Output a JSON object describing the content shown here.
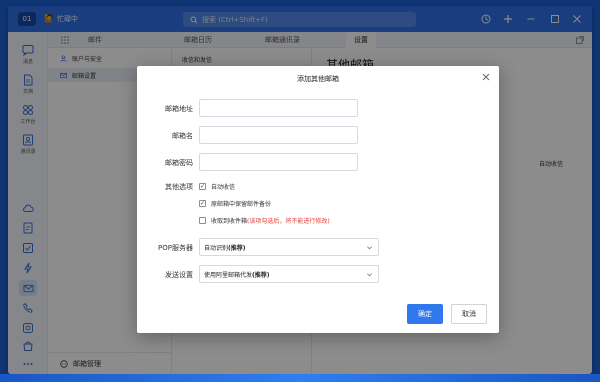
{
  "titlebar": {
    "user_badge": "01",
    "status_emoji": "🙋",
    "status_text": "忙碌中",
    "search_placeholder": "搜索 (Ctrl+Shift+F)"
  },
  "rail": {
    "items": [
      {
        "label": "消息",
        "icon": "message-icon"
      },
      {
        "label": "文档",
        "icon": "document-icon"
      },
      {
        "label": "工作台",
        "icon": "apps-icon"
      },
      {
        "label": "通讯录",
        "icon": "contacts-icon"
      }
    ]
  },
  "tabs": [
    {
      "label": "邮件"
    },
    {
      "label": "邮箱日历"
    },
    {
      "label": "邮箱通讯录"
    },
    {
      "label": "设置"
    }
  ],
  "sidebar": {
    "items": [
      {
        "label": "账户与安全"
      },
      {
        "label": "邮箱设置"
      }
    ],
    "footer": "邮箱管理"
  },
  "middle": {
    "first_item": "收信和发信"
  },
  "right": {
    "title_partial": "其他邮箱",
    "note": "自动收信"
  },
  "dialog": {
    "title": "添加其他邮箱",
    "fields": {
      "address_label": "邮箱地址",
      "name_label": "邮箱名",
      "password_label": "邮箱密码",
      "options_label": "其他选项",
      "pop_label": "POP服务器",
      "send_label": "发送设置"
    },
    "options": [
      {
        "text": "自动收信",
        "checked": true
      },
      {
        "text": "原邮箱中保留邮件备份",
        "checked": true
      },
      {
        "text": "收取到收件箱",
        "warning": "(该项勾选后，将不能进行修改)",
        "checked": false
      }
    ],
    "pop_value": "自动识别",
    "pop_suffix": "(推荐)",
    "send_value": "使用阿里邮箱代发",
    "send_suffix": "(推荐)",
    "confirm": "确定",
    "cancel": "取消"
  },
  "colors": {
    "titlebar": "#2e6fe6",
    "primary": "#2f78ee",
    "warning": "#e0443c"
  }
}
